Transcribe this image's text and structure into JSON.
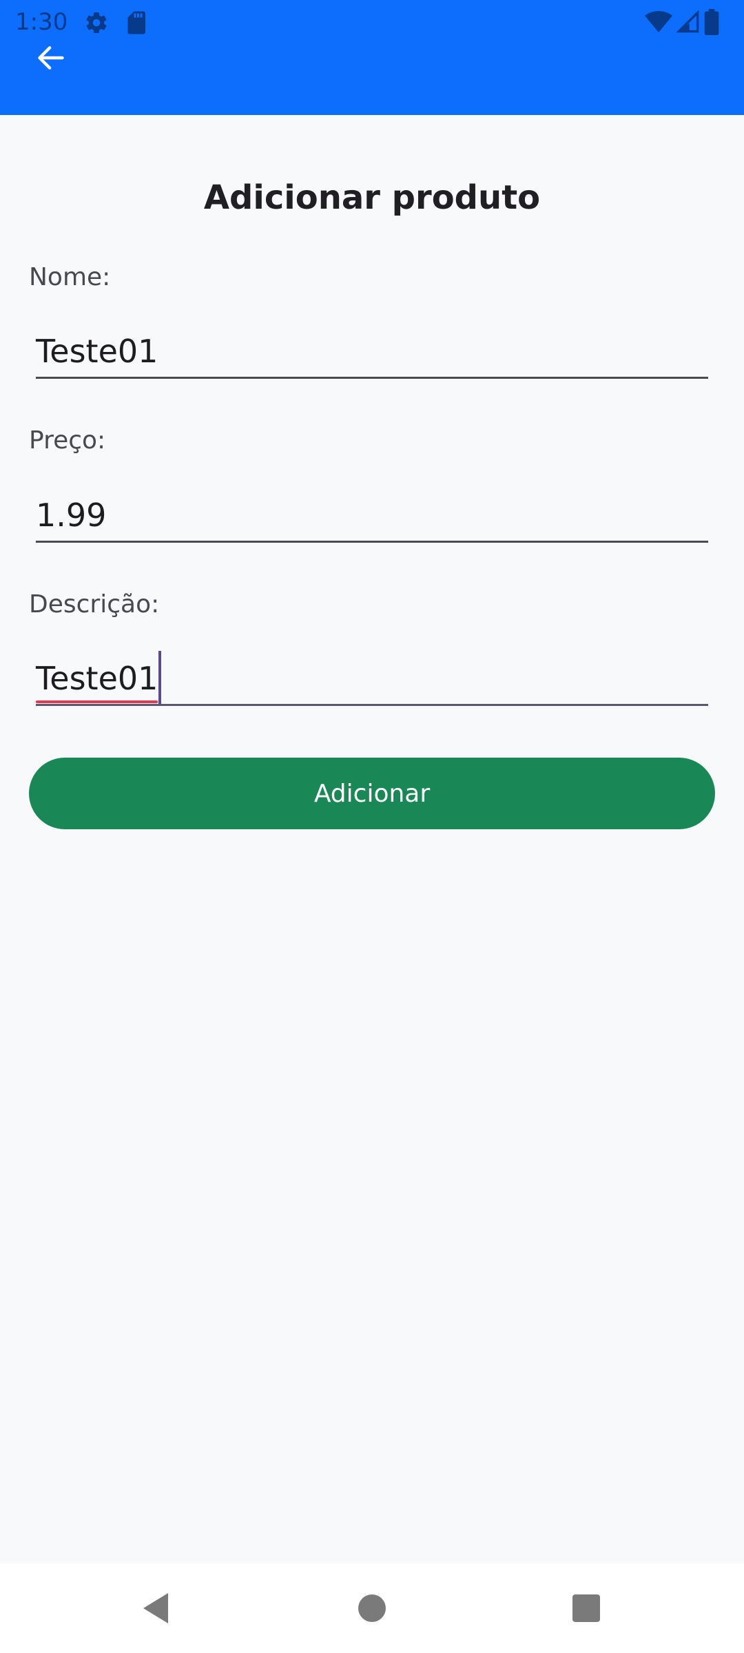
{
  "status_bar": {
    "time": "1:30",
    "icons": [
      "gear-icon",
      "sd-card-icon",
      "wifi-icon",
      "cellular-signal-icon",
      "battery-icon"
    ],
    "color": "#083a8c"
  },
  "app_bar": {
    "color": "#0d6efd",
    "back_icon": "arrow-left-icon"
  },
  "page": {
    "title": "Adicionar produto"
  },
  "form": {
    "nome": {
      "label": "Nome:",
      "value": "Teste01"
    },
    "preco": {
      "label": "Preço:",
      "value": "1.99"
    },
    "descricao": {
      "label": "Descrição:",
      "value": "Teste01",
      "focused": true
    }
  },
  "add_button": {
    "label": "Adicionar",
    "color": "#1a8856"
  },
  "nav_bar": {
    "icons": [
      "back-triangle-icon",
      "home-circle-icon",
      "recents-square-icon"
    ]
  }
}
